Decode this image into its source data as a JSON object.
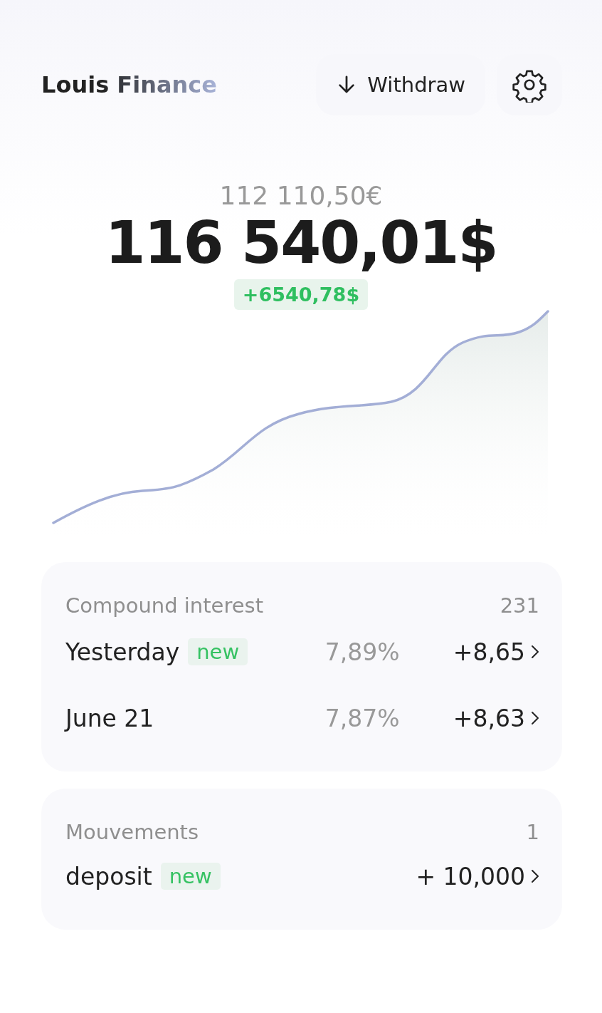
{
  "app": {
    "title": "Louis Finance"
  },
  "header": {
    "withdraw_button": "Withdraw"
  },
  "balance": {
    "secondary": "112 110,50€",
    "primary": "116 540,01$",
    "change": "+6540,78$"
  },
  "sections": [
    {
      "title": "Compound interest",
      "count": "231",
      "rows": [
        {
          "label": "Yesterday",
          "badge": "new",
          "rate": "7,89%",
          "amount": "+8,65"
        },
        {
          "label": "June 21",
          "rate": "7,87%",
          "amount": "+8,63"
        }
      ]
    },
    {
      "title": "Mouvements",
      "count": "1",
      "rows": [
        {
          "label": "deposit",
          "badge": "new",
          "amount": "+ 10,000"
        }
      ]
    }
  ]
}
